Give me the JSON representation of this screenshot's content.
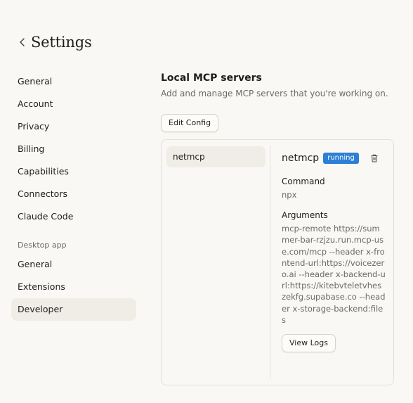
{
  "header": {
    "title": "Settings"
  },
  "sidebar": {
    "items": [
      "General",
      "Account",
      "Privacy",
      "Billing",
      "Capabilities",
      "Connectors",
      "Claude Code"
    ],
    "desktop_group_label": "Desktop app",
    "desktop_items": [
      "General",
      "Extensions",
      "Developer"
    ],
    "active": "Developer"
  },
  "main": {
    "title": "Local MCP servers",
    "subtitle": "Add and manage MCP servers that you're working on.",
    "edit_config_label": "Edit Config",
    "servers": [
      "netmcp"
    ],
    "detail": {
      "name": "netmcp",
      "status": "running",
      "status_color": "#2c7fd4",
      "command_label": "Command",
      "command": "npx",
      "arguments_label": "Arguments",
      "arguments": "mcp-remote https://summer-bar-rzjzu.run.mcp-use.com/mcp --header x-frontend-url:https://voicezero.ai --header x-backend-url:https://kitebvteletvheszekfg.supabase.co --header x-storage-backend:files",
      "view_logs_label": "View Logs"
    }
  },
  "icons": {
    "back": "chevron-left-icon",
    "delete": "trash-icon"
  }
}
